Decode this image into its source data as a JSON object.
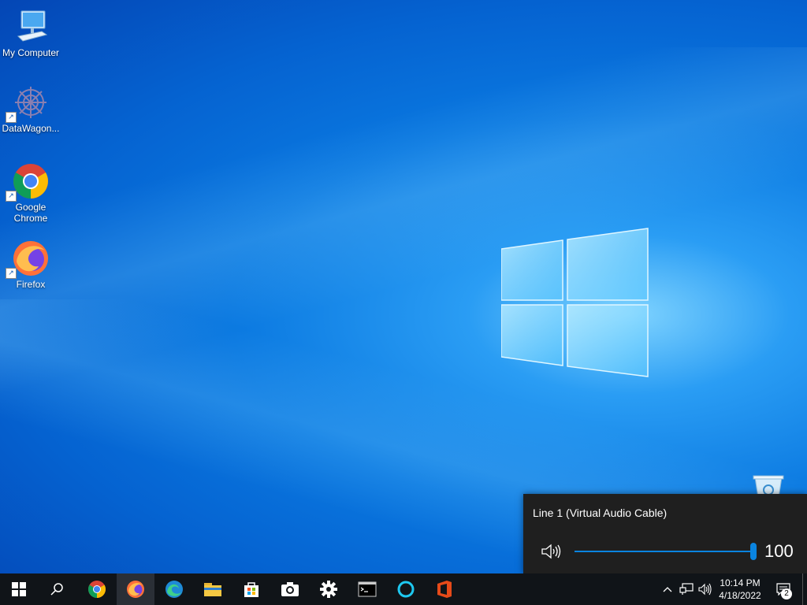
{
  "desktop": {
    "icons": [
      {
        "label": "My Computer",
        "icon": "computer-icon"
      },
      {
        "label": "DataWagon...",
        "icon": "datawagon-icon"
      },
      {
        "label": "Google Chrome",
        "icon": "chrome-icon"
      },
      {
        "label": "Firefox",
        "icon": "firefox-icon"
      }
    ],
    "recycle_bin_icon": "recycle-bin-icon"
  },
  "volume_flyout": {
    "device_name": "Line 1 (Virtual Audio Cable)",
    "volume": 100,
    "volume_display": "100",
    "icon": "speaker-icon",
    "accent": "#0a84e0"
  },
  "taskbar": {
    "apps": [
      {
        "name": "start",
        "icon": "windows-start-icon"
      },
      {
        "name": "search",
        "icon": "search-icon"
      },
      {
        "name": "chrome",
        "icon": "chrome-icon"
      },
      {
        "name": "firefox",
        "icon": "firefox-icon",
        "active": true
      },
      {
        "name": "edge",
        "icon": "edge-icon"
      },
      {
        "name": "file-explorer",
        "icon": "folder-icon"
      },
      {
        "name": "store",
        "icon": "store-icon"
      },
      {
        "name": "camera",
        "icon": "camera-icon"
      },
      {
        "name": "settings",
        "icon": "gear-icon"
      },
      {
        "name": "terminal",
        "icon": "terminal-icon"
      },
      {
        "name": "cortana",
        "icon": "cortana-icon"
      },
      {
        "name": "office",
        "icon": "office-icon"
      }
    ],
    "tray": {
      "time": "10:14 PM",
      "date": "4/18/2022",
      "notification_count": "2"
    }
  }
}
